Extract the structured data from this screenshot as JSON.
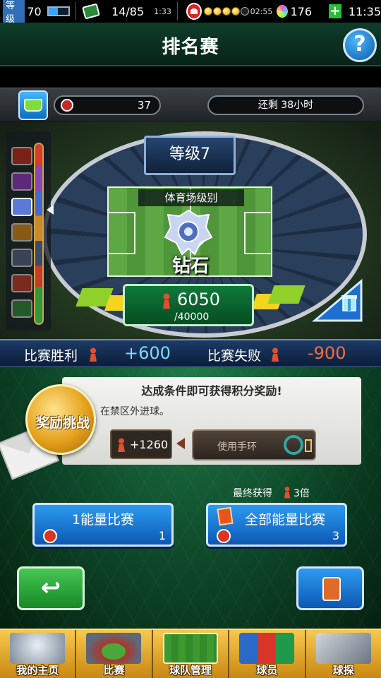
{
  "status_bar": {
    "level_tag": "等级",
    "level": "70",
    "cards": "14/85",
    "card_timer": "1:33",
    "energy_timer": "02:55",
    "energy_filled": 4,
    "energy_total": 5,
    "gems": "176",
    "clock": "11:35",
    "level_progress": 0.45
  },
  "header": {
    "title": "排名赛"
  },
  "info": {
    "points": "37",
    "time_remaining": "还剩 38小时"
  },
  "stadium": {
    "level_label": "等级7",
    "stadium_rank_label": "体育场级别",
    "rank_name": "钻石",
    "score": "6050",
    "score_target": "/40000"
  },
  "results": {
    "win_label": "比赛胜利",
    "win_value": "+600",
    "loss_label": "比赛失败",
    "loss_value": "-900",
    "win_color": "#7ad9ff",
    "loss_color": "#ff6a3d"
  },
  "challenge": {
    "medal_label": "奖励挑战",
    "title": "达成条件即可获得积分奖励!",
    "condition": "在禁区外进球。",
    "reward": "+1260",
    "bracelet_button": "使用手环"
  },
  "multiplier": {
    "prefix": "最终获得",
    "value": "3倍"
  },
  "buttons": {
    "single_match": "1能量比赛",
    "single_cost": "1",
    "all_match": "全部能量比赛",
    "all_cost": "3"
  },
  "bottom_nav": [
    {
      "label": "我的主页",
      "icon": "shield-crest-icon"
    },
    {
      "label": "比赛",
      "icon": "stadium-icon"
    },
    {
      "label": "球队管理",
      "icon": "tactics-board-icon"
    },
    {
      "label": "球员",
      "icon": "players-icon"
    },
    {
      "label": "球探",
      "icon": "scout-cards-icon"
    }
  ],
  "colors": {
    "accent_blue": "#2d9af0",
    "back_green": "#45c653",
    "nav_gold": "#f7c84f"
  }
}
